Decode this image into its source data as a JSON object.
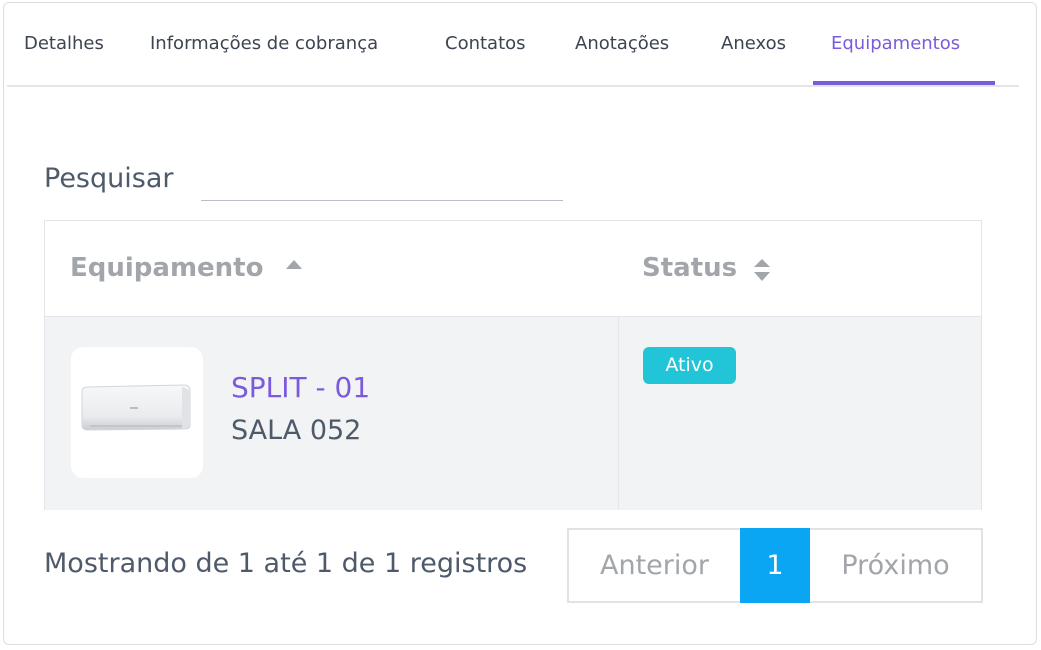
{
  "tabs": [
    {
      "label": "Detalhes"
    },
    {
      "label": "Informações de cobrança"
    },
    {
      "label": "Contatos"
    },
    {
      "label": "Anotações"
    },
    {
      "label": "Anexos"
    },
    {
      "label": "Equipamentos"
    }
  ],
  "active_tab": "Equipamentos",
  "search": {
    "label": "Pesquisar",
    "value": ""
  },
  "table": {
    "columns": [
      {
        "label": "Equipamento",
        "sort": "ascending"
      },
      {
        "label": "Status",
        "sort": "unsorted"
      }
    ],
    "rows": [
      {
        "name": "SPLIT - 01",
        "room": "SALA 052",
        "status": "Ativo",
        "image_icon": "split-air-conditioner"
      }
    ]
  },
  "footer": {
    "info": "Mostrando de 1 até 1 de 1 registros",
    "pagination": {
      "prev": "Anterior",
      "current": "1",
      "next": "Próximo"
    }
  },
  "colors": {
    "accent": "#7b5bdc",
    "badge": "#22c4d8",
    "page_active": "#0aa5f3"
  }
}
